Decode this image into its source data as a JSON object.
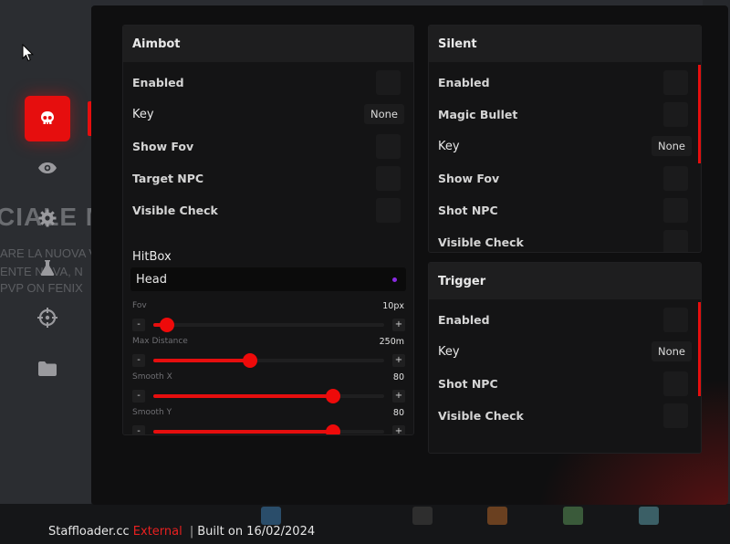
{
  "theme": {
    "accent": "#e60e0e",
    "panel_bg": "#141415",
    "header_bg": "#1e1e1f",
    "window_bg": "#0f0f10"
  },
  "background": {
    "big_text": "CIALE M",
    "lines": [
      "ARE LA NUOVA V",
      "ENTE NOVA, N",
      "PVP ON FENIX"
    ]
  },
  "sidebar": {
    "items": [
      {
        "icon": "skull-icon",
        "active": true
      },
      {
        "icon": "eye-icon",
        "active": false
      },
      {
        "icon": "gear-icon",
        "active": false
      },
      {
        "icon": "flask-icon",
        "active": false
      },
      {
        "icon": "crosshair-icon",
        "active": false
      },
      {
        "icon": "folder-icon",
        "active": false
      }
    ]
  },
  "aimbot": {
    "title": "Aimbot",
    "enabled_label": "Enabled",
    "key_label": "Key",
    "key_value": "None",
    "show_fov_label": "Show Fov",
    "target_npc_label": "Target NPC",
    "visible_check_label": "Visible Check",
    "hitbox_label": "HitBox",
    "hitbox_value": "Head",
    "sliders": [
      {
        "label": "Fov",
        "value": "10px",
        "fraction": 0.06
      },
      {
        "label": "Max Distance",
        "value": "250m",
        "fraction": 0.42
      },
      {
        "label": "Smooth X",
        "value": "80",
        "fraction": 0.78
      },
      {
        "label": "Smooth Y",
        "value": "80",
        "fraction": 0.78
      }
    ],
    "minus": "-",
    "plus": "+"
  },
  "silent": {
    "title": "Silent",
    "enabled_label": "Enabled",
    "magic_bullet_label": "Magic Bullet",
    "key_label": "Key",
    "key_value": "None",
    "show_fov_label": "Show Fov",
    "shot_npc_label": "Shot NPC",
    "visible_check_label": "Visible Check"
  },
  "trigger": {
    "title": "Trigger",
    "enabled_label": "Enabled",
    "key_label": "Key",
    "key_value": "None",
    "shot_npc_label": "Shot NPC",
    "visible_check_label": "Visible Check"
  },
  "footer": {
    "brand": "Staffloader.cc",
    "edition": "External",
    "separator": "|",
    "built": "Built on 16/02/2024"
  }
}
